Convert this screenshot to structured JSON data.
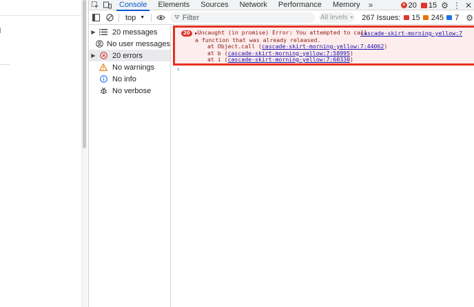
{
  "tabs": [
    {
      "label": "Console",
      "active": true
    },
    {
      "label": "Elements"
    },
    {
      "label": "Sources"
    },
    {
      "label": "Network"
    },
    {
      "label": "Performance"
    },
    {
      "label": "Memory"
    }
  ],
  "tab_right": {
    "error_count": "20",
    "issue_count": "15"
  },
  "toolbar": {
    "context": "top",
    "filter_placeholder": "Filter",
    "levels": "All levels",
    "issues_label": "267 Issues:",
    "issues_red": "15",
    "issues_orange": "245",
    "issues_blue": "7"
  },
  "sidebar": {
    "items": [
      {
        "label": "20 messages",
        "icon": "list-icon",
        "expandable": true
      },
      {
        "label": "No user messages",
        "icon": "user-icon",
        "expandable": false
      },
      {
        "label": "20 errors",
        "icon": "error-icon",
        "expandable": true
      },
      {
        "label": "No warnings",
        "icon": "warning-icon",
        "expandable": false
      },
      {
        "label": "No info",
        "icon": "info-icon",
        "expandable": false
      },
      {
        "label": "No verbose",
        "icon": "bug-icon",
        "expandable": false
      }
    ]
  },
  "console": {
    "badge": "20",
    "message": "Uncaught (in promise) Error: You attempted to call",
    "message_link": "cascade-skirt-morning-yellow:7",
    "message_line2": "a function that was already released.",
    "stack": [
      {
        "prefix": "at Object.call (",
        "link": "cascade-skirt-morning-yellow:7:44062",
        "suffix": ")"
      },
      {
        "prefix": "at b (",
        "link": "cascade-skirt-morning-yellow:7:58995",
        "suffix": ")"
      },
      {
        "prefix": "at i (",
        "link": "cascade-skirt-morning-yellow:7:60330",
        "suffix": ")"
      }
    ]
  },
  "colors": {
    "accent": "#0b57d0",
    "error": "#dc362e",
    "highlight_border": "#e53021"
  }
}
